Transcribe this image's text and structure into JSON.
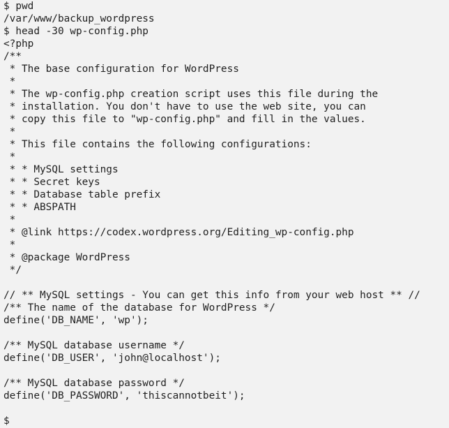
{
  "terminal": {
    "lines": [
      "$ pwd",
      "/var/www/backup_wordpress",
      "$ head -30 wp-config.php",
      "<?php",
      "/**",
      " * The base configuration for WordPress",
      " *",
      " * The wp-config.php creation script uses this file during the",
      " * installation. You don't have to use the web site, you can",
      " * copy this file to \"wp-config.php\" and fill in the values.",
      " *",
      " * This file contains the following configurations:",
      " *",
      " * * MySQL settings",
      " * * Secret keys",
      " * * Database table prefix",
      " * * ABSPATH",
      " *",
      " * @link https://codex.wordpress.org/Editing_wp-config.php",
      " *",
      " * @package WordPress",
      " */",
      "",
      "// ** MySQL settings - You can get this info from your web host ** //",
      "/** The name of the database for WordPress */",
      "define('DB_NAME', 'wp');",
      "",
      "/** MySQL database username */",
      "define('DB_USER', 'john@localhost');",
      "",
      "/** MySQL database password */",
      "define('DB_PASSWORD', 'thiscannotbeit');",
      "",
      "$"
    ]
  }
}
